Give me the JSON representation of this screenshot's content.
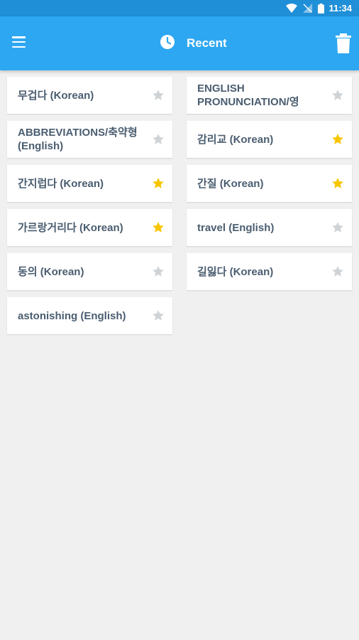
{
  "status_bar": {
    "time": "11:34"
  },
  "app_bar": {
    "title": "Recent",
    "icons": [
      "menu-icon",
      "clock-icon",
      "trash-icon"
    ]
  },
  "colors": {
    "app_bar": "#2ea7f2",
    "status_bar": "#1f8fd8",
    "star_active": "#f7c600",
    "star_inactive": "#cfd3d6"
  },
  "left_column": [
    {
      "label": "무겁다 (Korean)",
      "starred": false
    },
    {
      "label": "ABBREVIATIONS/축약형 (English)",
      "starred": false
    },
    {
      "label": "간지럽다 (Korean)",
      "starred": true
    },
    {
      "label": "가르랑거리다 (Korean)",
      "starred": true
    },
    {
      "label": "동의 (Korean)",
      "starred": false
    },
    {
      "label": "astonishing (English)",
      "starred": false
    }
  ],
  "right_column": [
    {
      "label": "ENGLISH PRONUNCIATION/영",
      "starred": false
    },
    {
      "label": "감리교 (Korean)",
      "starred": true
    },
    {
      "label": "간질 (Korean)",
      "starred": true
    },
    {
      "label": "travel (English)",
      "starred": false
    },
    {
      "label": "길잃다 (Korean)",
      "starred": false
    }
  ]
}
